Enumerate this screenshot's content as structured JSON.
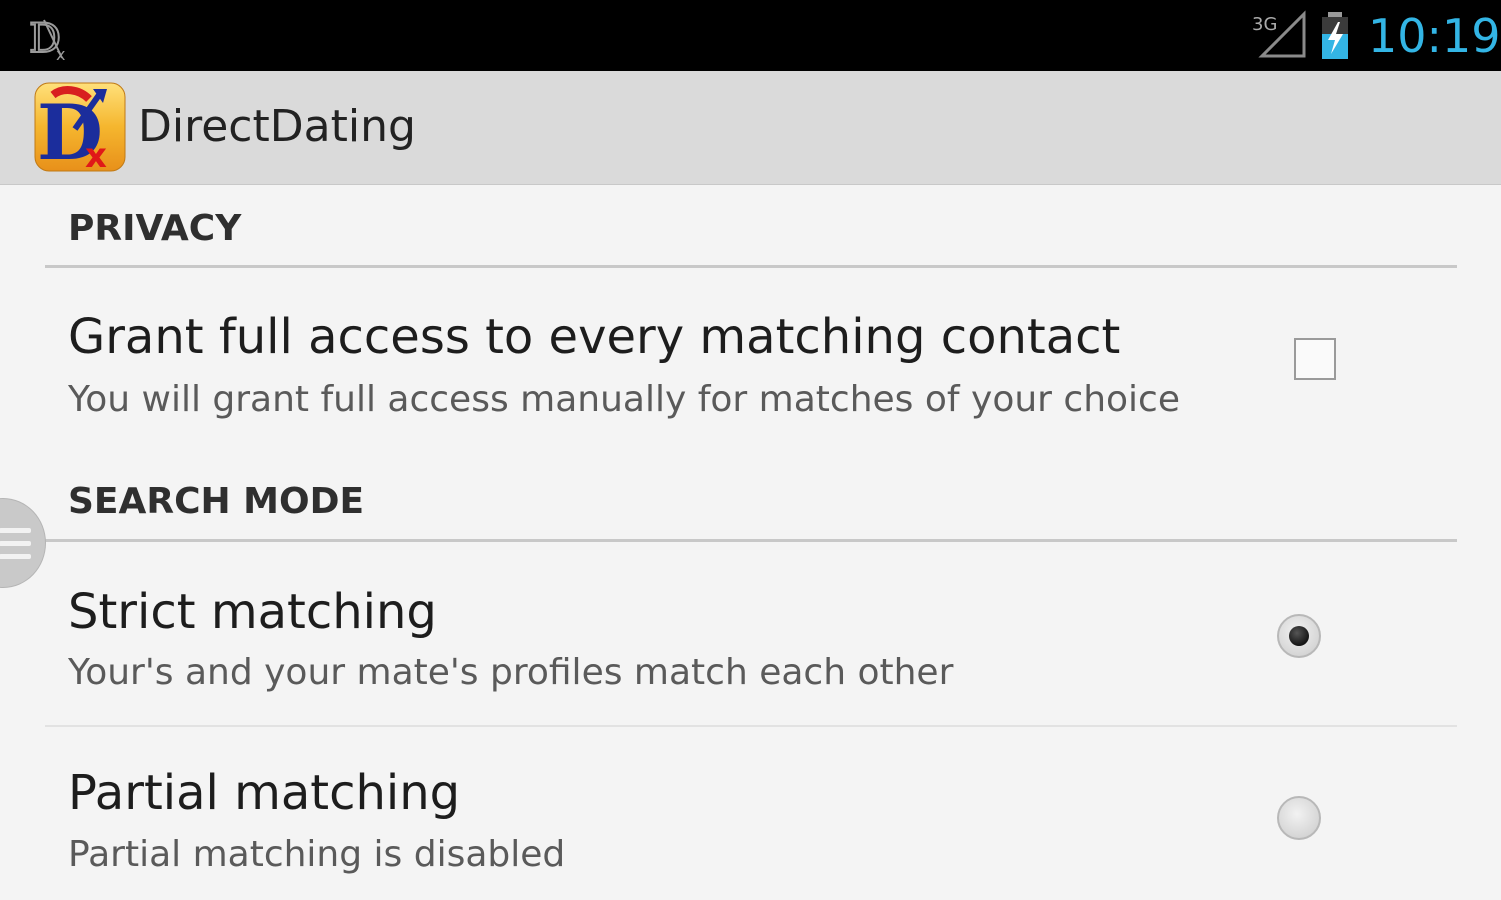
{
  "status_bar": {
    "time": "10:19",
    "network": "3G",
    "icons": [
      "directdating-notification-icon",
      "signal-icon",
      "battery-charging-icon"
    ],
    "time_color": "#33b5e5"
  },
  "action_bar": {
    "app_title": "DirectDating",
    "logo": "directdating-logo"
  },
  "sections": {
    "privacy": {
      "header": "PRIVACY",
      "items": [
        {
          "title": "Grant full access to every matching contact",
          "summary": "You will grant full access manually for matches of your choice",
          "checked": false
        }
      ]
    },
    "search_mode": {
      "header": "SEARCH MODE",
      "items": [
        {
          "title": "Strict matching",
          "summary": "Your's and your mate's profiles match each other",
          "selected": true
        },
        {
          "title": "Partial matching",
          "summary": "Partial matching is disabled",
          "selected": false
        }
      ]
    }
  },
  "colors": {
    "background": "#f4f4f4",
    "action_bar": "#dadada",
    "status_bar": "#000000",
    "accent": "#33b5e5"
  }
}
